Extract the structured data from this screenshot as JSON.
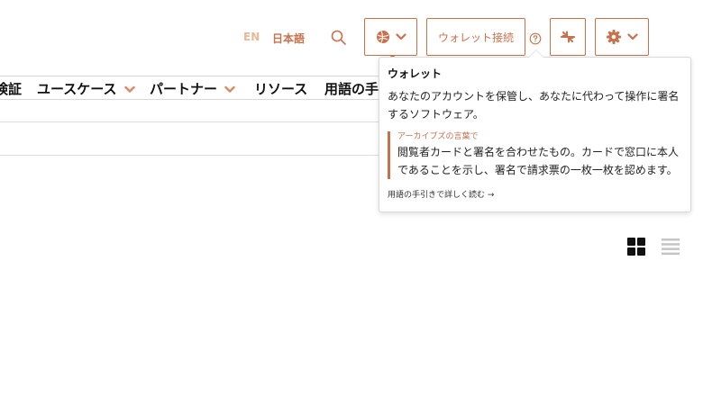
{
  "header": {
    "lang_en": "EN",
    "lang_ja": "日本語",
    "wallet_button": "ウォレット接続",
    "icons": [
      "search-icon",
      "network-icon",
      "chevron-down-icon",
      "help-icon",
      "collapse-icon",
      "gear-icon"
    ]
  },
  "nav": {
    "partial_item": "検証",
    "items": [
      "ユースケース",
      "パートナー",
      "リソース",
      "用語の手"
    ]
  },
  "tooltip": {
    "title": "ウォレット",
    "description": "あなたのアカウントを保管し、あなたに代わって操作に署名するソフトウェア。",
    "quote_label": "アーカイブズの言葉で",
    "quote_text": "閲覧者カードと署名を合わせたもの。カードで窓口に本人であることを示し、署名で請求票の一枚一枚を認めます。",
    "link": "用語の手引きで詳しく読む →"
  },
  "view": {
    "icons": [
      "grid-view-icon",
      "list-view-icon"
    ]
  },
  "colors": {
    "accent": "#c8714a",
    "accent_light": "#e8b79a",
    "text": "#111111",
    "border": "#d9d9d9"
  }
}
